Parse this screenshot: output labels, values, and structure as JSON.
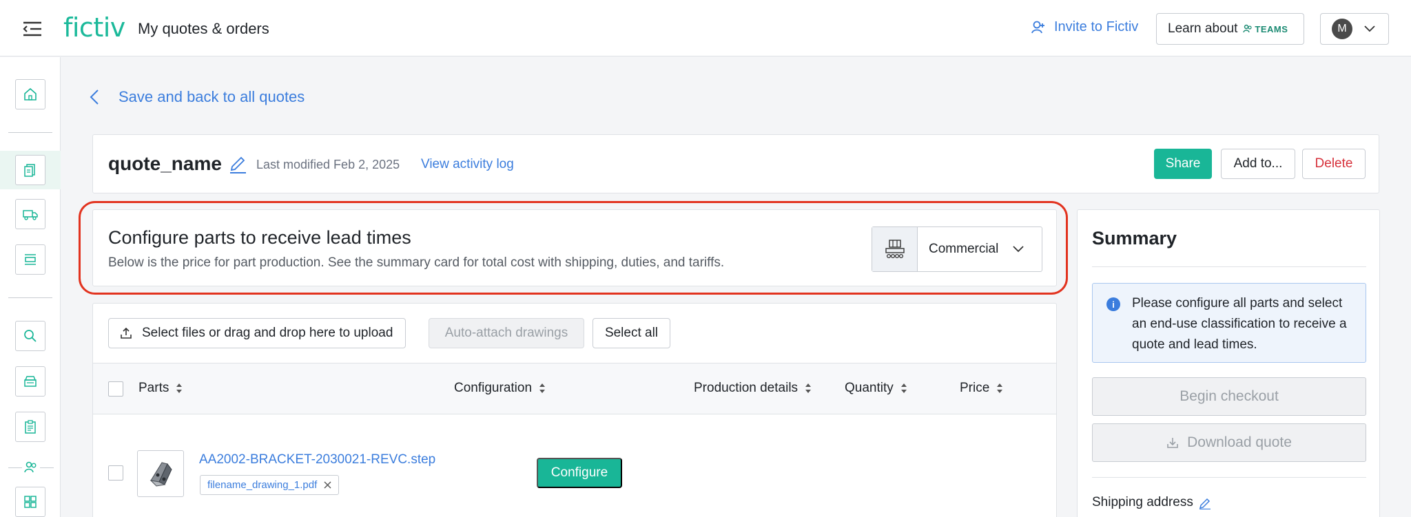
{
  "header": {
    "logo": "fictiv",
    "title": "My quotes & orders",
    "invite_label": "Invite to Fictiv",
    "learn_label": "Learn about",
    "teams_label": "TEAMS",
    "avatar_initial": "M"
  },
  "sidebar": {
    "items": [
      {
        "icon": "home-icon"
      },
      {
        "icon": "quotes-icon",
        "active": true
      },
      {
        "icon": "truck-icon"
      },
      {
        "icon": "inbox-icon"
      },
      {
        "icon": "search-icon"
      },
      {
        "icon": "printer-icon"
      },
      {
        "icon": "clipboard-icon"
      },
      {
        "icon": "team-icon"
      },
      {
        "icon": "grid-icon"
      }
    ]
  },
  "nav": {
    "back_label": "Save and back to all quotes"
  },
  "quote": {
    "name": "quote_name",
    "last_modified": "Last modified Feb 2, 2025",
    "activity_link": "View activity log",
    "share_label": "Share",
    "addto_label": "Add to...",
    "delete_label": "Delete"
  },
  "config": {
    "title": "Configure parts to receive lead times",
    "subtitle": "Below is the price for part production. See the summary card for total cost with shipping, duties, and tariffs.",
    "classification": "Commercial"
  },
  "parts": {
    "upload_label": "Select files or drag and drop here to upload",
    "autoattach_label": "Auto-attach drawings",
    "selectall_label": "Select all",
    "columns": [
      "Parts",
      "Configuration",
      "Production details",
      "Quantity",
      "Price"
    ],
    "rows": [
      {
        "filename": "AA2002-BRACKET-2030021-REVC.step",
        "drawing": "filename_drawing_1.pdf",
        "configure_label": "Configure"
      }
    ]
  },
  "summary": {
    "title": "Summary",
    "info": "Please configure all parts and select an end-use classification to receive a quote and lead times.",
    "checkout_label": "Begin checkout",
    "download_label": "Download quote",
    "shipping_label": "Shipping address"
  },
  "colors": {
    "brand": "#19b697",
    "link": "#3b7ddd",
    "danger": "#d6303a",
    "highlight": "#e2331f"
  }
}
